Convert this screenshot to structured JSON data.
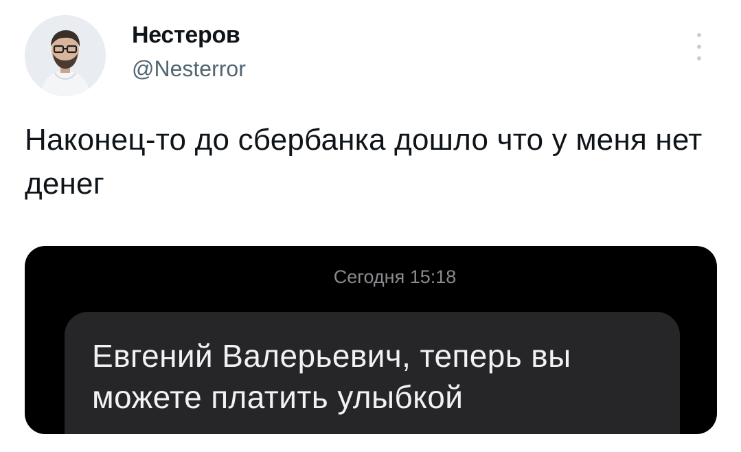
{
  "author": {
    "display_name": "Нестеров",
    "handle": "@Nesterror"
  },
  "tweet": {
    "text": "Наконец-то до сбербанка дошло что у меня нет денег"
  },
  "media": {
    "timestamp": "Сегодня 15:18",
    "message": "Евгений Валерьевич, теперь вы можете платить улыбкой"
  },
  "icons": {
    "more": "more-vertical-icon"
  }
}
